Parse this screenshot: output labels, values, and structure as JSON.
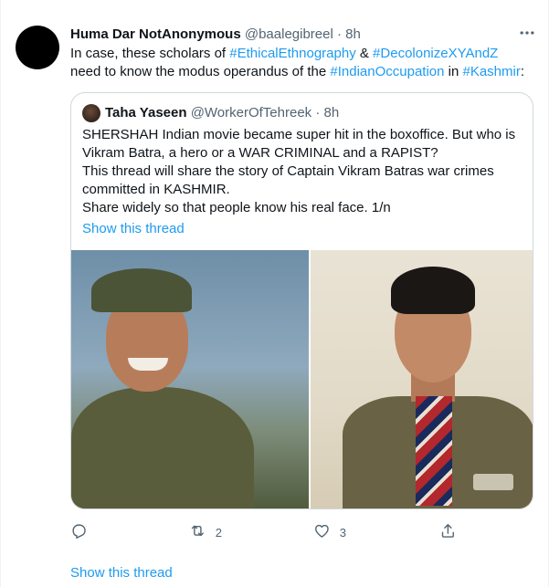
{
  "tweet": {
    "author_name": "Huma Dar NotAnonymous",
    "author_handle": "@baalegibreel",
    "separator": "·",
    "time": "8h",
    "text": {
      "line1_pre": "In case, these scholars of ",
      "hashtag1": "#EthicalEthnography",
      "amp": " & ",
      "hashtag2": "#DecolonizeXYAndZ",
      "line2_pre": "need to know the modus operandus of the ",
      "hashtag3": "#IndianOccupation",
      "in": " in ",
      "hashtag4": "#Kashmir",
      "colon": ":"
    },
    "actions": {
      "retweets": "2",
      "likes": "3"
    },
    "show_thread": "Show this thread"
  },
  "quote": {
    "author_name": "Taha Yaseen",
    "author_handle": "@WorkerOfTehreek",
    "separator": "·",
    "time": "8h",
    "lines": [
      "SHERSHAH Indian movie became super hit in the boxoffice. But who is",
      "Vikram Batra, a hero or a WAR CRIMINAL and a RAPIST?",
      "This thread will share the story of Captain Vikram Batras war crimes",
      "committed in KASHMIR.",
      "Share widely so that people know his real face. 1/n"
    ],
    "show_thread": "Show this thread"
  },
  "icons": {
    "more": "more-icon",
    "reply": "reply-icon",
    "retweet": "retweet-icon",
    "like": "heart-icon",
    "share": "share-icon"
  },
  "colors": {
    "link": "#1d9bf0",
    "secondary_text": "#536471",
    "primary_text": "#0f1419",
    "border": "#cfd9de"
  }
}
